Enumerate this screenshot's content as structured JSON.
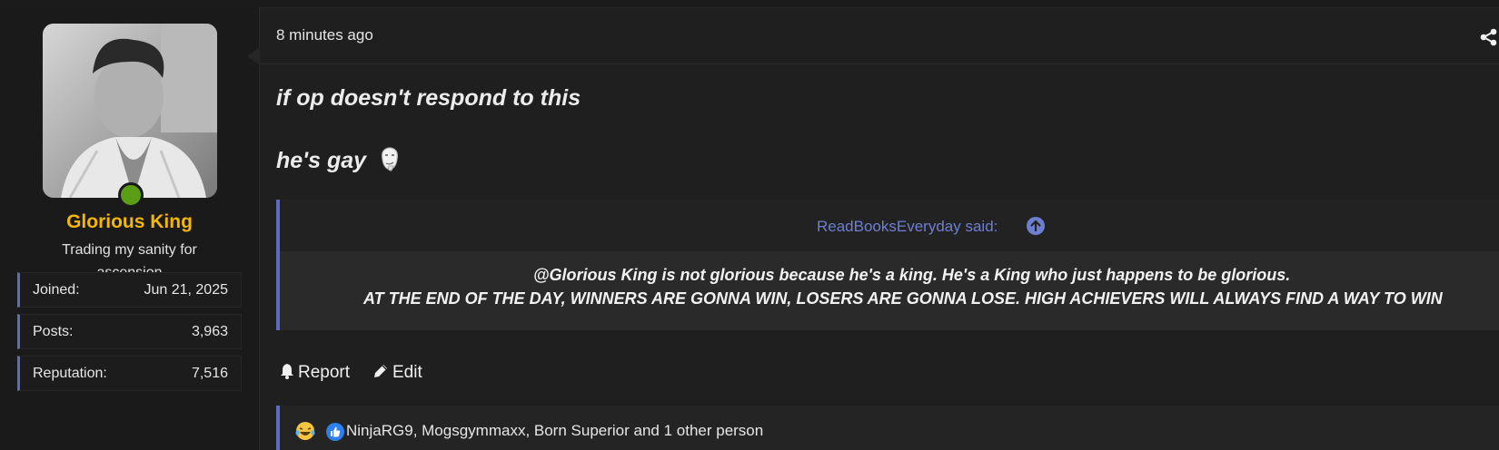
{
  "user": {
    "name": "Glorious King",
    "title": "Trading my sanity for ascension",
    "name_color": "#f5b800",
    "online_color": "#5c9d16",
    "stats": [
      {
        "label": "Joined:",
        "value": "Jun 21, 2025"
      },
      {
        "label": "Posts:",
        "value": "3,963"
      },
      {
        "label": "Reputation:",
        "value": "7,516"
      }
    ]
  },
  "post": {
    "time": "8 minutes ago",
    "share_icon": "share-icon",
    "lines": [
      "if op doesn't respond to this",
      "he's gay"
    ],
    "emoji": "thinking-face-emoji",
    "quote": {
      "author": "ReadBooksEveryday said:",
      "lines": [
        "@Glorious King is not glorious because he's a king. He's a King who just happens to be glorious.",
        "AT THE END OF THE DAY, WINNERS ARE GONNA WIN, LOSERS ARE GONNA LOSE. HIGH ACHIEVERS WILL ALWAYS FIND A WAY TO WIN"
      ],
      "accent": "#5c6bc0"
    },
    "actions": [
      {
        "label": "Report",
        "icon": "bell-icon"
      },
      {
        "label": "Edit",
        "icon": "pencil-icon"
      }
    ],
    "reactions": {
      "icons": [
        "laughing-tears-emoji",
        "thumbs-up-icon"
      ],
      "users": "NinjaRG9, Mogsgymmaxx, Born Superior and 1 other person"
    }
  }
}
